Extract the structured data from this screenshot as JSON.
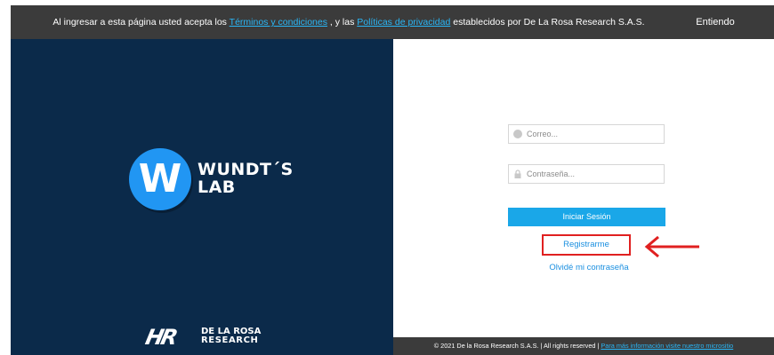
{
  "cookie_bar": {
    "text_before": "Al ingresar a esta página usted acepta los",
    "terms_link": "Términos y condiciones",
    "text_middle": ", y las",
    "privacy_link": "Políticas de privacidad",
    "text_after": "establecidos por De La Rosa Research S.A.S.",
    "accept_label": "Entiendo"
  },
  "brand": {
    "logo_letter": "W",
    "name_line1": "WUNDT´S",
    "name_line2": "LAB"
  },
  "company_logo": {
    "mark": "HR",
    "line1": "DE LA ROSA",
    "line2": "RESEARCH"
  },
  "login": {
    "email_placeholder": "Correo...",
    "password_placeholder": "Contraseña...",
    "submit_label": "Iniciar Sesión",
    "register_label": "Registrarme",
    "forgot_label": "Olvidé mi contraseña"
  },
  "footer": {
    "text": "© 2021 De la Rosa Research S.A.S. | All rights reserved |",
    "link": "Para más información visite nuestro micrositio"
  },
  "colors": {
    "left_panel_bg": "#0b2a4a",
    "accent_blue": "#1aa7e8",
    "logo_blue": "#2196f3",
    "bar_bg": "#3b3b3b",
    "highlight_red": "#e02020"
  }
}
